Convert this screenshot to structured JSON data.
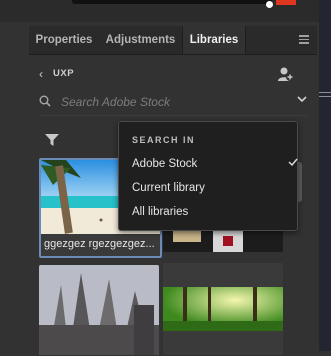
{
  "tabs": [
    {
      "label": "Properties"
    },
    {
      "label": "Adjustments"
    },
    {
      "label": "Libraries"
    }
  ],
  "library": {
    "name": "UXP"
  },
  "search": {
    "placeholder": "Search Adobe Stock"
  },
  "dropdown": {
    "title": "SEARCH IN",
    "options": [
      {
        "label": "Adobe Stock",
        "selected": true
      },
      {
        "label": "Current library",
        "selected": false
      },
      {
        "label": "All libraries",
        "selected": false
      }
    ]
  },
  "grid": {
    "items": [
      {
        "label": "ggezgez rgezgezgez..."
      }
    ]
  },
  "colors": {
    "panel_bg": "#323232",
    "accent": "#6b8bb8",
    "dropdown_bg": "#1f1f1f"
  }
}
